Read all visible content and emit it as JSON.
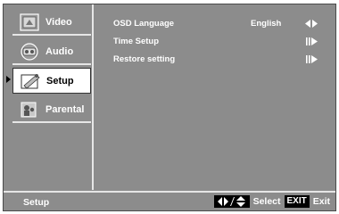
{
  "sidebar": {
    "items": [
      {
        "label": "Video",
        "icon": "video-icon",
        "selected": false
      },
      {
        "label": "Audio",
        "icon": "audio-icon",
        "selected": false
      },
      {
        "label": "Setup",
        "icon": "setup-icon",
        "selected": true
      },
      {
        "label": "Parental",
        "icon": "parental-icon",
        "selected": false
      }
    ]
  },
  "main": {
    "rows": [
      {
        "label": "OSD Language",
        "value": "English",
        "arrow": "left-right-arrow-icon"
      },
      {
        "label": "Time Setup",
        "value": "",
        "arrow": "enter-arrow-icon"
      },
      {
        "label": "Restore setting",
        "value": "",
        "arrow": "enter-arrow-icon"
      }
    ]
  },
  "footer": {
    "title": "Setup",
    "select_label": "Select",
    "exit_key": "EXIT",
    "exit_label": "Exit"
  },
  "colors": {
    "background": "#8c8c8c",
    "divider": "#e6e6e6",
    "selected_bg": "#ffffff"
  }
}
